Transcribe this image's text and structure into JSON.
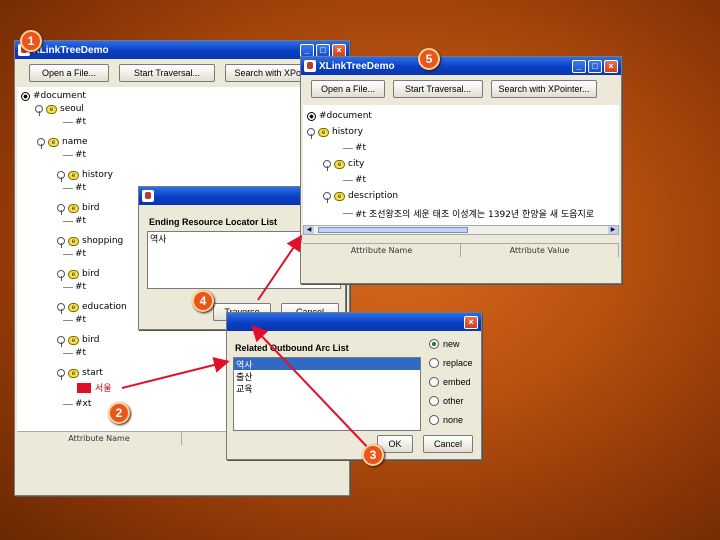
{
  "colors": {
    "callout": "#e8561a",
    "titlebar": "#0a3fc4",
    "arrow": "#e0102a",
    "selection": "#316ac5"
  },
  "callouts": {
    "c1": "1",
    "c2": "2",
    "c3": "3",
    "c4": "4",
    "c5": "5"
  },
  "main_window": {
    "title": "XLinkTreeDemo",
    "buttons": {
      "open": "Open a File...",
      "traverse": "Start Traversal...",
      "search": "Search with XPointer..."
    },
    "tree": [
      {
        "label": "#document",
        "kind": "doc"
      },
      {
        "label": "seoul",
        "kind": "elem"
      },
      {
        "label": "#t",
        "kind": "text"
      },
      {
        "label": "name",
        "kind": "elem"
      },
      {
        "label": "#t",
        "kind": "text"
      },
      {
        "label": "history",
        "kind": "elem"
      },
      {
        "label": "#t",
        "kind": "text"
      },
      {
        "label": "bird",
        "kind": "elem"
      },
      {
        "label": "#t",
        "kind": "text"
      },
      {
        "label": "shopping",
        "kind": "elem"
      },
      {
        "label": "#t",
        "kind": "text"
      },
      {
        "label": "bird",
        "kind": "elem"
      },
      {
        "label": "#t",
        "kind": "text"
      },
      {
        "label": "education",
        "kind": "elem"
      },
      {
        "label": "#t",
        "kind": "text"
      },
      {
        "label": "bird",
        "kind": "elem"
      },
      {
        "label": "#t",
        "kind": "text"
      },
      {
        "label": "start",
        "kind": "elem"
      },
      {
        "label": "서울",
        "kind": "highlight"
      },
      {
        "label": "#xt",
        "kind": "text"
      }
    ],
    "table_headers": [
      "Attribute Name",
      ""
    ]
  },
  "ending_dialog": {
    "title_icon": "java-icon",
    "label": "Ending Resource Locator List",
    "items": [
      "역사"
    ],
    "traverse": "Traverse",
    "cancel": "Cancel"
  },
  "arc_dialog": {
    "label": "Related Outbound Arc List",
    "items": [
      "역사",
      "출산",
      "교육"
    ],
    "radios": [
      {
        "label": "new",
        "checked": true
      },
      {
        "label": "replace",
        "checked": false
      },
      {
        "label": "embed",
        "checked": false
      },
      {
        "label": "other",
        "checked": false
      },
      {
        "label": "none",
        "checked": false
      }
    ],
    "ok": "OK",
    "cancel": "Cancel"
  },
  "result_window": {
    "title": "XLinkTreeDemo",
    "buttons": {
      "open": "Open a File...",
      "traverse": "Start Traversal...",
      "search": "Search with XPointer..."
    },
    "tree": [
      {
        "label": "#document",
        "kind": "doc"
      },
      {
        "label": "history",
        "kind": "elem"
      },
      {
        "label": "#t",
        "kind": "text"
      },
      {
        "label": "city",
        "kind": "elem"
      },
      {
        "label": "#t",
        "kind": "text"
      },
      {
        "label": "description",
        "kind": "elem"
      },
      {
        "label": "#t    조선왕조의 세운 태조 이성계는 1392년 한양을    새 도읍지로",
        "kind": "text"
      }
    ],
    "table_headers": [
      "Attribute Name",
      "Attribute Value"
    ]
  }
}
